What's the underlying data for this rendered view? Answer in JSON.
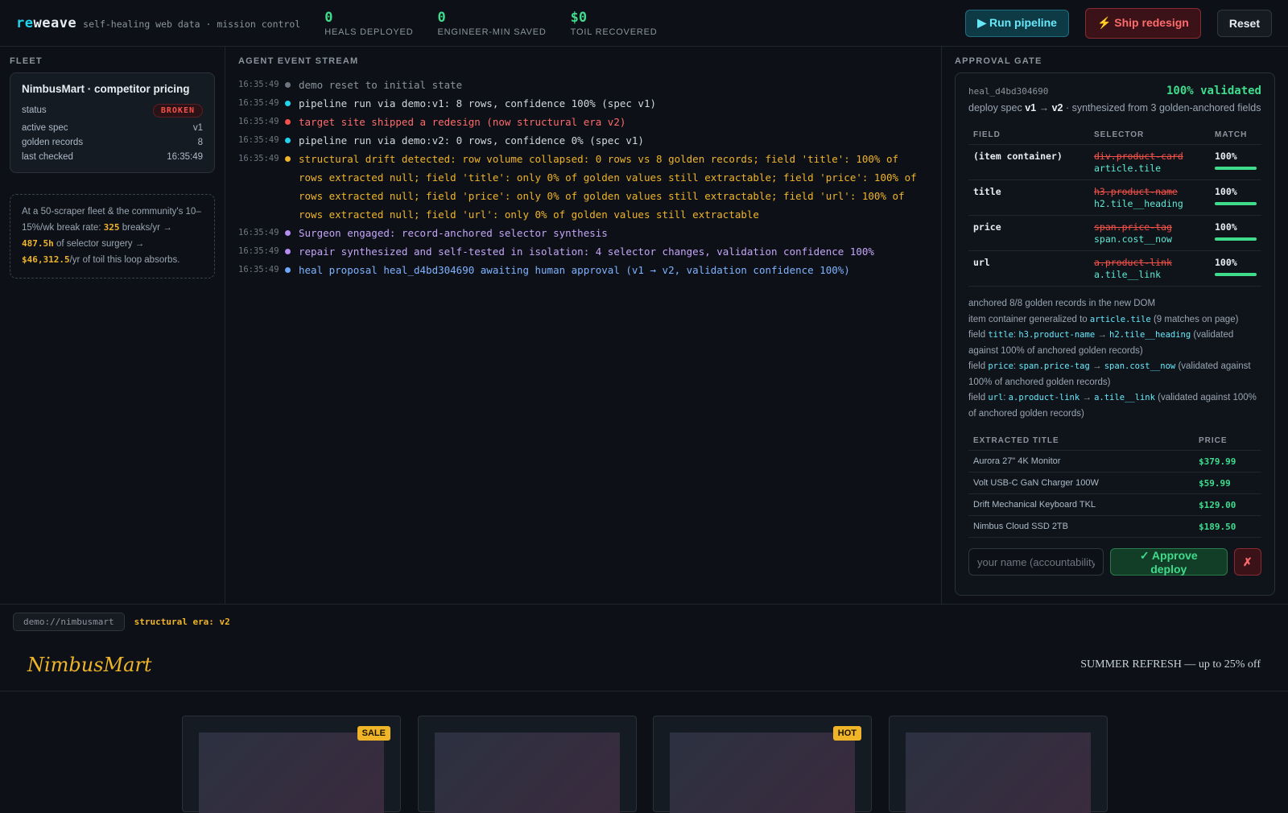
{
  "header": {
    "logo_prefix": "re",
    "logo_rest": "weave",
    "tagline": "self-healing web data · mission control",
    "stats": [
      {
        "value": "0",
        "label": "HEALS DEPLOYED"
      },
      {
        "value": "0",
        "label": "ENGINEER-MIN SAVED"
      },
      {
        "value": "$0",
        "label": "TOIL RECOVERED"
      }
    ],
    "run_label": "▶ Run pipeline",
    "ship_label": "⚡ Ship redesign",
    "reset_label": "Reset"
  },
  "fleet": {
    "title": "FLEET",
    "card": {
      "name": "NimbusMart · competitor pricing",
      "status_label": "status",
      "status_value": "BROKEN",
      "spec_label": "active spec",
      "spec_value": "v1",
      "golden_label": "golden records",
      "golden_value": "8",
      "checked_label": "last checked",
      "checked_value": "16:35:49"
    },
    "note": {
      "line1": "At a 50-scraper fleet & the community's 10–15%/wk break rate:",
      "breaks": "325",
      "breaks_suffix": "breaks/yr →",
      "hours": "487.5h",
      "hours_suffix": "of selector surgery →",
      "dollars": "$46,312.5",
      "dollars_suffix": "/yr of toil this loop absorbs."
    }
  },
  "stream": {
    "title": "AGENT EVENT STREAM",
    "events": [
      {
        "time": "16:35:49",
        "dot": "#6e7681",
        "color": "#8b949e",
        "msg": "demo reset to initial state"
      },
      {
        "time": "16:35:49",
        "dot": "#22d3ee",
        "color": "#d0d7de",
        "msg": "pipeline run via demo:v1: 8 rows, confidence 100% (spec v1)"
      },
      {
        "time": "16:35:49",
        "dot": "#f85149",
        "color": "#ff6b6b",
        "msg": "target site shipped a redesign (now structural era v2)"
      },
      {
        "time": "16:35:49",
        "dot": "#22d3ee",
        "color": "#d0d7de",
        "msg": "pipeline run via demo:v2: 0 rows, confidence 0% (spec v1)"
      },
      {
        "time": "16:35:49",
        "dot": "#f0b429",
        "color": "#f0b429",
        "msg": "structural drift detected: row volume collapsed: 0 rows vs 8 golden records; field 'title': 100% of rows extracted null; field 'title': only 0% of golden values still extractable; field 'price': 100% of rows extracted null; field 'price': only 0% of golden values still extractable; field 'url': 100% of rows extracted null; field 'url': only 0% of golden values still extractable"
      },
      {
        "time": "16:35:49",
        "dot": "#b48cf2",
        "color": "#c4a5f7",
        "msg": "Surgeon engaged: record-anchored selector synthesis"
      },
      {
        "time": "16:35:49",
        "dot": "#b48cf2",
        "color": "#c4a5f7",
        "msg": "repair synthesized and self-tested in isolation: 4 selector changes, validation confidence 100%"
      },
      {
        "time": "16:35:49",
        "dot": "#6ea8fe",
        "color": "#7fb2ff",
        "msg": "heal proposal heal_d4bd304690 awaiting human approval (v1 → v2, validation confidence 100%)"
      }
    ]
  },
  "gate": {
    "title": "APPROVAL GATE",
    "heal_id": "heal_d4bd304690",
    "validated": "100% validated",
    "deploy_prefix": "deploy spec",
    "from_spec": "v1",
    "arrow": "→",
    "to_spec": "v2",
    "deploy_suffix": "· synthesized from 3 golden-anchored fields",
    "field_headers": {
      "field": "FIELD",
      "selector": "SELECTOR",
      "match": "MATCH"
    },
    "fields": [
      {
        "name": "(item container)",
        "old": "div.product-card",
        "new": "article.tile",
        "match": "100%",
        "fill": 1.0
      },
      {
        "name": "title",
        "old": "h3.product-name",
        "new": "h2.tile__heading",
        "match": "100%",
        "fill": 1.0
      },
      {
        "name": "price",
        "old": "span.price-tag",
        "new": "span.cost__now",
        "match": "100%",
        "fill": 1.0
      },
      {
        "name": "url",
        "old": "a.product-link",
        "new": "a.tile__link",
        "match": "100%",
        "fill": 1.0
      }
    ],
    "notes": {
      "anchored": "anchored 8/8 golden records in the new DOM",
      "container_prefix": "item container generalized to",
      "container_sel": "article.tile",
      "container_suffix": "(9 matches on page)",
      "field_word": "field",
      "validated_suffix": "(validated against 100% of anchored golden records)",
      "items": [
        {
          "field": "title",
          "old": "h3.product-name",
          "new": "h2.tile__heading"
        },
        {
          "field": "price",
          "old": "span.price-tag",
          "new": "span.cost__now"
        },
        {
          "field": "url",
          "old": "a.product-link",
          "new": "a.tile__link"
        }
      ]
    },
    "preview_headers": {
      "title": "EXTRACTED TITLE",
      "price": "PRICE"
    },
    "preview_rows": [
      {
        "title": "Aurora 27\" 4K Monitor",
        "price": "$379.99"
      },
      {
        "title": "Volt USB-C GaN Charger 100W",
        "price": "$59.99"
      },
      {
        "title": "Drift Mechanical Keyboard TKL",
        "price": "$129.00"
      },
      {
        "title": "Nimbus Cloud SSD 2TB",
        "price": "$189.50"
      }
    ],
    "name_placeholder": "your name (accountability)",
    "approve_label": "✓ Approve deploy",
    "reject_label": "✗"
  },
  "preview": {
    "url": "demo://nimbusmart",
    "era": "structural era: v2",
    "site_logo": "NimbusMart",
    "promo": "SUMMER REFRESH — up to 25% off",
    "tiles": [
      {
        "tag": "SALE"
      },
      {
        "tag": ""
      },
      {
        "tag": "HOT"
      },
      {
        "tag": ""
      }
    ]
  }
}
